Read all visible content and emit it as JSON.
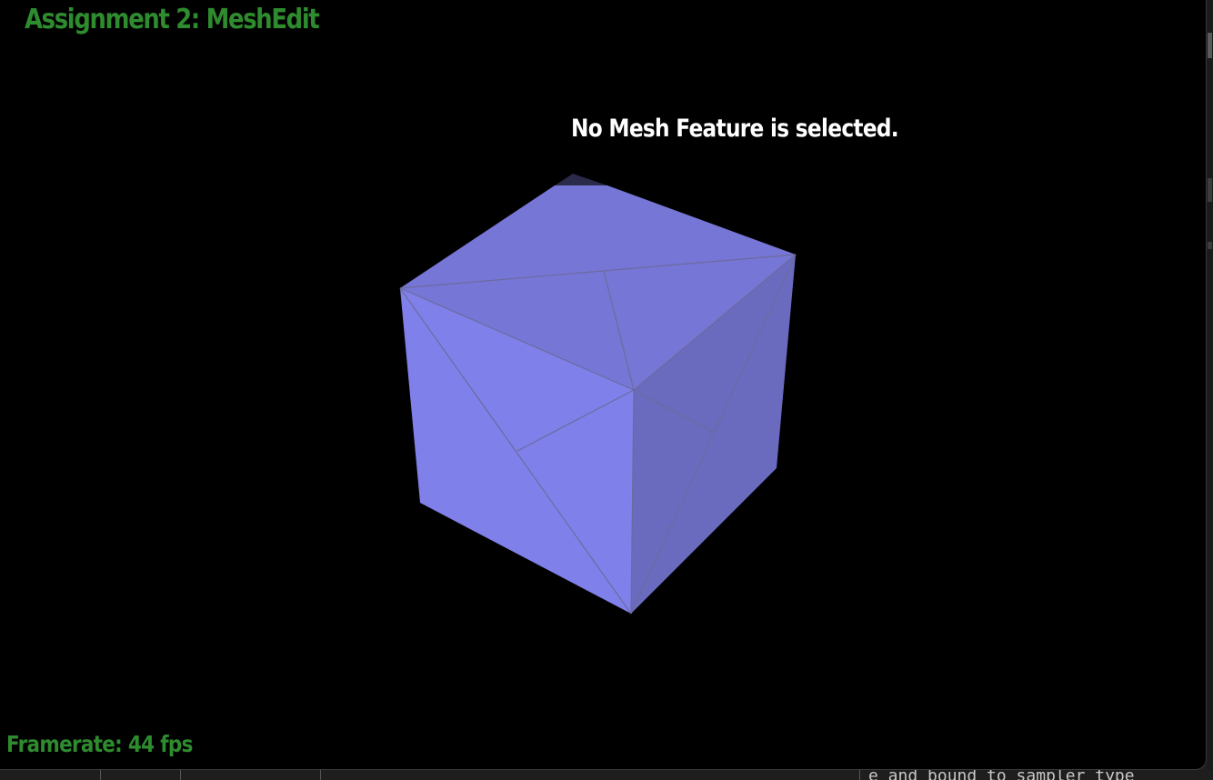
{
  "window": {
    "title": "Assignment 2: MeshEdit",
    "selection_status": "No Mesh Feature is selected.",
    "framerate": "Framerate: 44 fps"
  },
  "mesh": {
    "kind": "cube",
    "face_color": "#8080ea",
    "edge_color": "#6b6b9e"
  },
  "background_window": {
    "code_snippet": "e and bound to sampler type"
  },
  "colors": {
    "title_green": "#2e8b2e",
    "status_white": "#ffffff",
    "background": "#000000"
  }
}
